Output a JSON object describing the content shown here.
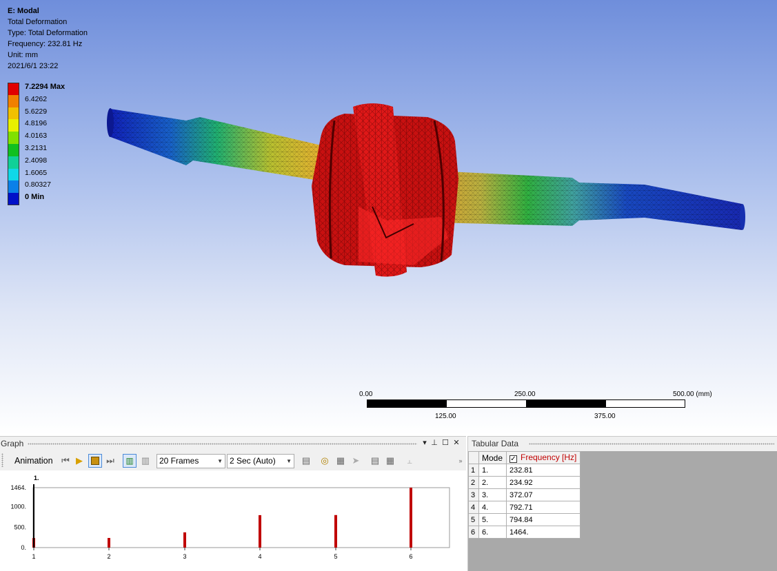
{
  "info": {
    "title": "E: Modal",
    "result_name": "Total Deformation",
    "type": "Type: Total Deformation",
    "frequency": "Frequency: 232.81 Hz",
    "unit": "Unit: mm",
    "datetime": "2021/6/1 23:22"
  },
  "legend": [
    {
      "label": "7.2294 Max",
      "color": "#e00000",
      "bold": true
    },
    {
      "label": "6.4262",
      "color": "#f08000",
      "bold": false
    },
    {
      "label": "5.6229",
      "color": "#f0c000",
      "bold": false
    },
    {
      "label": "4.8196",
      "color": "#e8f000",
      "bold": false
    },
    {
      "label": "4.0163",
      "color": "#80e000",
      "bold": false
    },
    {
      "label": "3.2131",
      "color": "#10c020",
      "bold": false
    },
    {
      "label": "2.4098",
      "color": "#10d098",
      "bold": false
    },
    {
      "label": "1.6065",
      "color": "#10d8e8",
      "bold": false
    },
    {
      "label": "0.80327",
      "color": "#0a80e8",
      "bold": false
    },
    {
      "label": "0 Min",
      "color": "#0010c8",
      "bold": true
    }
  ],
  "scalebar": {
    "labels_top": [
      "0.00",
      "250.00",
      "500.00 (mm)"
    ],
    "labels_bottom": [
      "125.00",
      "375.00"
    ]
  },
  "graph_panel": {
    "title": "Graph",
    "animation_label": "Animation",
    "frames_select": "20 Frames",
    "duration_select": "2 Sec (Auto)"
  },
  "tabular_panel": {
    "title": "Tabular Data",
    "columns": [
      "Mode",
      "Frequency [Hz]"
    ],
    "rows": [
      {
        "index": "1",
        "mode": "1.",
        "frequency": "232.81"
      },
      {
        "index": "2",
        "mode": "2.",
        "frequency": "234.92"
      },
      {
        "index": "3",
        "mode": "3.",
        "frequency": "372.07"
      },
      {
        "index": "4",
        "mode": "4.",
        "frequency": "792.71"
      },
      {
        "index": "5",
        "mode": "5.",
        "frequency": "794.84"
      },
      {
        "index": "6",
        "mode": "6.",
        "frequency": "1464."
      }
    ]
  },
  "chart_data": {
    "type": "bar",
    "categories": [
      "1",
      "2",
      "3",
      "4",
      "5",
      "6"
    ],
    "values": [
      232.81,
      234.92,
      372.07,
      792.71,
      794.84,
      1464
    ],
    "ylim": [
      0,
      1464
    ],
    "y_ticks": [
      "1464.",
      "1000.",
      "500.",
      "0."
    ],
    "y_tick_values": [
      1464,
      1000,
      500,
      0
    ],
    "current_mode_label": "1.",
    "bar_color": "#c00000"
  }
}
